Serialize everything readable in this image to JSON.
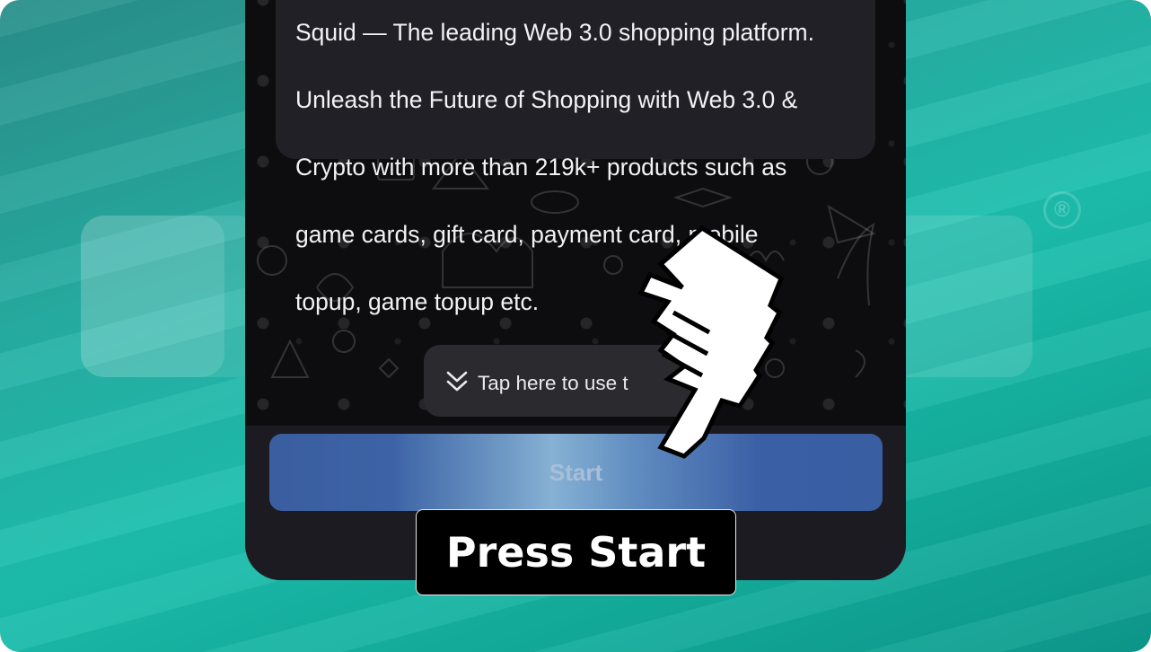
{
  "background": {
    "watermark_mark": "®"
  },
  "message": {
    "lines": [
      "Squid — The leading Web 3.0 shopping platform.",
      "Unleash the Future of Shopping with Web 3.0 &",
      "Crypto with more than 219k+ products such as",
      "game cards, gift card, payment card, mobile",
      "topup, game topup etc."
    ]
  },
  "hint": {
    "icon": "double-chevron-down-icon",
    "text": "Tap here to use t"
  },
  "start_button": {
    "label": "Start"
  },
  "caption": {
    "label": "Press Start"
  },
  "cursor": {
    "icon": "pointing-hand-cursor-icon"
  },
  "colors": {
    "teal_bg": "#1dbfae",
    "chat_bg": "#0d0d10",
    "bubble_bg": "#212027",
    "start_button": "#3a5ea0",
    "caption_bg": "#000000"
  }
}
